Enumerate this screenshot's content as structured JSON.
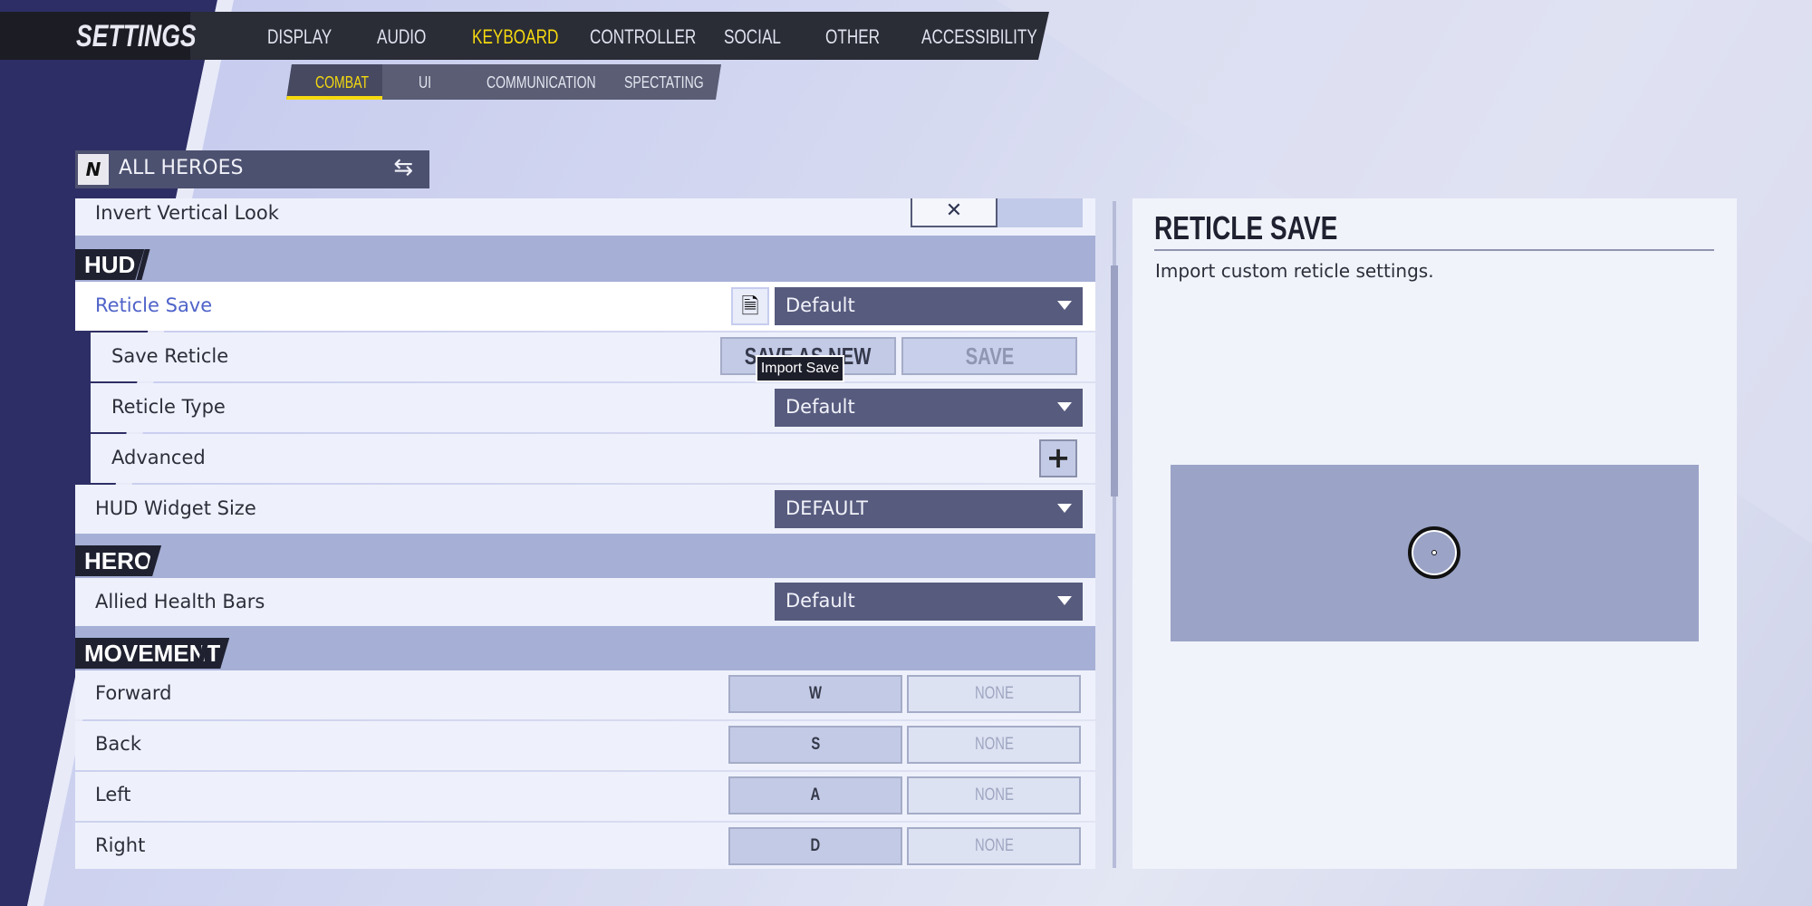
{
  "header": {
    "title": "SETTINGS",
    "tabs": [
      "DISPLAY",
      "AUDIO",
      "KEYBOARD",
      "CONTROLLER",
      "SOCIAL",
      "OTHER",
      "ACCESSIBILITY"
    ],
    "active_tab": "KEYBOARD"
  },
  "subtabs": {
    "items": [
      "COMBAT",
      "UI",
      "COMMUNICATION",
      "SPECTATING"
    ],
    "active": "COMBAT"
  },
  "hero_select": {
    "label": "ALL HEROES"
  },
  "settings": {
    "invert_vertical_look": {
      "label": "Invert Vertical Look",
      "value": "✕"
    },
    "hud_header": "HUD",
    "reticle_save": {
      "label": "Reticle Save",
      "value": "Default"
    },
    "save_reticle": {
      "label": "Save Reticle",
      "save_as_new": "SAVE AS NEW",
      "save": "SAVE"
    },
    "tooltip": "Import Save",
    "reticle_type": {
      "label": "Reticle Type",
      "value": "Default"
    },
    "advanced": {
      "label": "Advanced",
      "button": "+"
    },
    "hud_widget_size": {
      "label": "HUD Widget Size",
      "value": "DEFAULT"
    },
    "hero_header": "HERO",
    "allied_health_bars": {
      "label": "Allied Health Bars",
      "value": "Default"
    },
    "movement_header": "MOVEMENT",
    "movement": [
      {
        "label": "Forward",
        "primary": "W",
        "secondary": "NONE"
      },
      {
        "label": "Back",
        "primary": "S",
        "secondary": "NONE"
      },
      {
        "label": "Left",
        "primary": "A",
        "secondary": "NONE"
      },
      {
        "label": "Right",
        "primary": "D",
        "secondary": "NONE"
      }
    ]
  },
  "detail": {
    "title": "RETICLE SAVE",
    "description": "Import custom reticle settings."
  },
  "colors": {
    "accent": "#f5d90f",
    "dropdown": "#575b7e",
    "highlight_text": "#4f63c9"
  }
}
